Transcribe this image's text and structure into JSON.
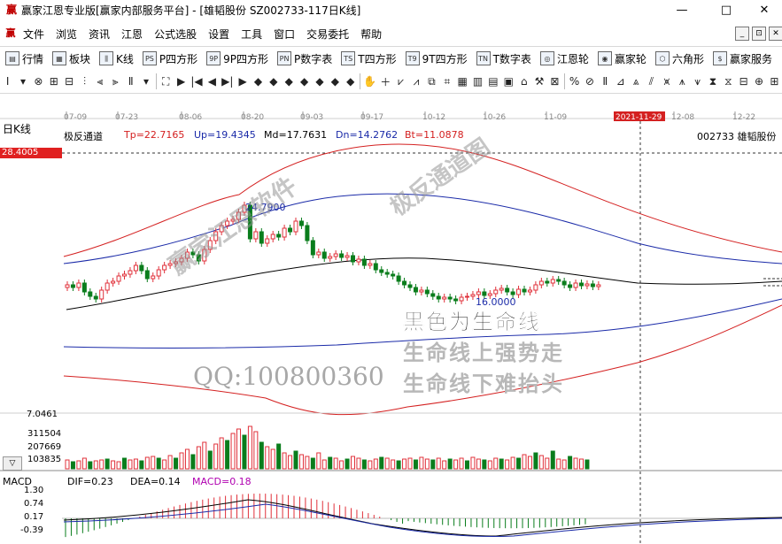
{
  "window": {
    "title": "赢家江恩专业版[赢家内部服务平台] - [雄韬股份   SZ002733-117日K线]",
    "app_icon": "赢",
    "controls": {
      "minimize": "—",
      "maximize": "□",
      "close": "✕"
    }
  },
  "menu": {
    "icon": "赢",
    "items": [
      "文件",
      "浏览",
      "资讯",
      "江恩",
      "公式选股",
      "设置",
      "工具",
      "窗口",
      "交易委托",
      "帮助"
    ],
    "mdi": [
      "_",
      "⊡",
      "✕"
    ]
  },
  "toolbar": {
    "items": [
      {
        "label": "行情",
        "icon": "quote-icon",
        "glyph": "▤"
      },
      {
        "label": "板块",
        "icon": "sector-icon",
        "glyph": "▦"
      },
      {
        "label": "K线",
        "icon": "kline-icon",
        "glyph": "⫼"
      },
      {
        "label": "P四方形",
        "icon": "ps-icon",
        "glyph": "PS"
      },
      {
        "label": "9P四方形",
        "icon": "9p-icon",
        "glyph": "9P"
      },
      {
        "label": "P数字表",
        "icon": "pn-icon",
        "glyph": "PN"
      },
      {
        "label": "T四方形",
        "icon": "ts-icon",
        "glyph": "TS"
      },
      {
        "label": "9T四方形",
        "icon": "9t-icon",
        "glyph": "T9"
      },
      {
        "label": "T数字表",
        "icon": "tn-icon",
        "glyph": "TN"
      },
      {
        "label": "江恩轮",
        "icon": "gann-wheel-icon",
        "glyph": "◎"
      },
      {
        "label": "赢家轮",
        "icon": "winner-wheel-icon",
        "glyph": "◉"
      },
      {
        "label": "六角形",
        "icon": "hexagon-icon",
        "glyph": "⬡"
      },
      {
        "label": "赢家服务",
        "icon": "service-icon",
        "glyph": "$"
      }
    ]
  },
  "chart": {
    "panel_label": "日K线",
    "date_ticks": [
      "07-09",
      "07-23",
      "08-06",
      "08-20",
      "09-03",
      "09-17",
      "10-12",
      "10-26",
      "11-09",
      "2021-11-29",
      "12-08",
      "12-22"
    ],
    "highlight_date": "2021-11-29",
    "indicator": {
      "name": "极反通道",
      "tp": "Tp=22.7165",
      "up": "Up=19.4345",
      "md": "Md=17.7631",
      "dn": "Dn=14.2762",
      "bt": "Bt=11.0878"
    },
    "stock": "002733  雄韬股份",
    "price_box": "28.4005",
    "high_label": "24.7900",
    "low_label": "16.0000",
    "watermarks": {
      "diag1": "赢家江恩软件",
      "diag2": "极反通道图",
      "line1": "黑色为生命线",
      "line2": "生命线上强势走",
      "line3": "生命线下难抬头",
      "qq": "QQ:100800360"
    },
    "volume_axis": [
      "7.0461",
      "311504",
      "207669",
      "103835"
    ],
    "macd": {
      "label": "MACD",
      "dif": "DIF=0.23",
      "dea": "DEA=0.14",
      "macd": "MACD=0.18",
      "axis": [
        "1.30",
        "0.74",
        "0.17",
        "-0.39"
      ]
    },
    "colors": {
      "up": "#e0303a",
      "down": "#0a7d1c",
      "red_line": "#d42020",
      "blue_line": "#1a2aa8",
      "life_line": "#000000"
    }
  }
}
